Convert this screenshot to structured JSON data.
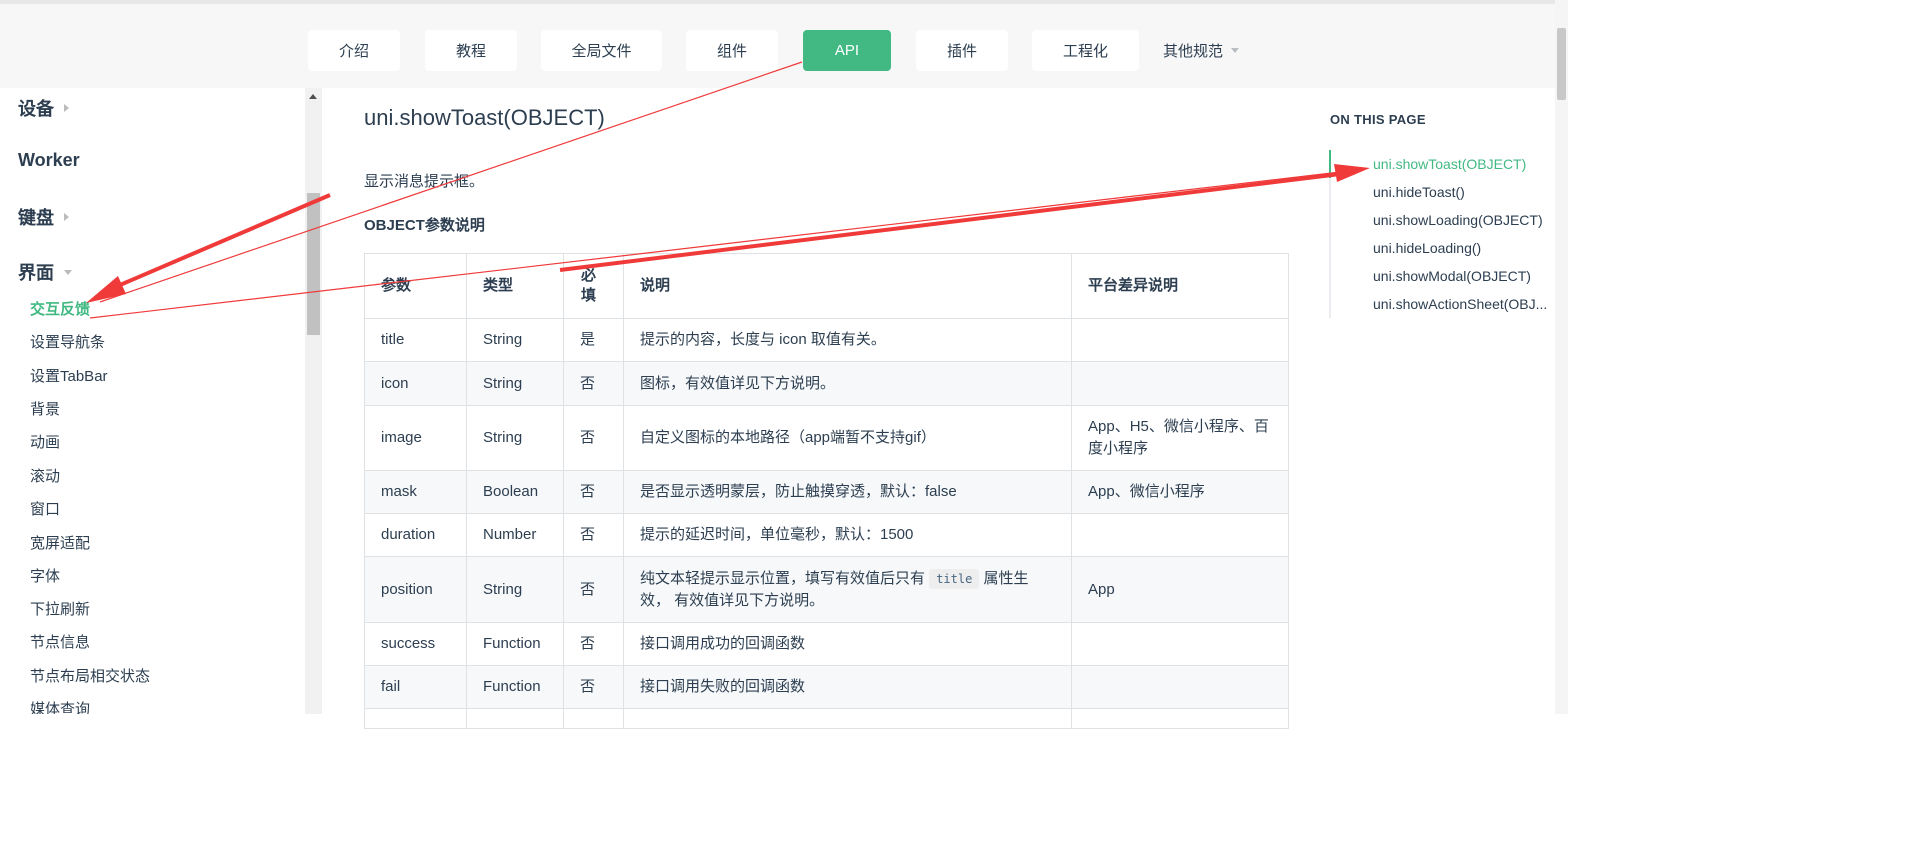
{
  "top_nav": {
    "items": [
      {
        "label": "介绍"
      },
      {
        "label": "教程"
      },
      {
        "label": "全局文件"
      },
      {
        "label": "组件"
      },
      {
        "label": "API"
      },
      {
        "label": "插件"
      },
      {
        "label": "工程化"
      },
      {
        "label": "其他规范"
      }
    ]
  },
  "sidebar": {
    "groups": [
      {
        "label": "设备"
      },
      {
        "label": "Worker"
      },
      {
        "label": "键盘"
      },
      {
        "label": "界面"
      }
    ],
    "items": [
      {
        "label": "交互反馈"
      },
      {
        "label": "设置导航条"
      },
      {
        "label": "设置TabBar"
      },
      {
        "label": "背景"
      },
      {
        "label": "动画"
      },
      {
        "label": "滚动"
      },
      {
        "label": "窗口"
      },
      {
        "label": "宽屏适配"
      },
      {
        "label": "字体"
      },
      {
        "label": "下拉刷新"
      },
      {
        "label": "节点信息"
      },
      {
        "label": "节点布局相交状态"
      },
      {
        "label": "媒体查询"
      }
    ]
  },
  "content": {
    "title": "uni.showToast(OBJECT)",
    "description": "显示消息提示框。",
    "section_title": "OBJECT参数说明",
    "table": {
      "headers": [
        "参数",
        "类型",
        "必填",
        "说明",
        "平台差异说明"
      ],
      "rows": [
        {
          "param": "title",
          "type": "String",
          "required": "是",
          "desc": "提示的内容，长度与 icon 取值有关。",
          "platform": ""
        },
        {
          "param": "icon",
          "type": "String",
          "required": "否",
          "desc": "图标，有效值详见下方说明。",
          "platform": ""
        },
        {
          "param": "image",
          "type": "String",
          "required": "否",
          "desc": "自定义图标的本地路径（app端暂不支持gif）",
          "platform": "App、H5、微信小程序、百度小程序"
        },
        {
          "param": "mask",
          "type": "Boolean",
          "required": "否",
          "desc": "是否显示透明蒙层，防止触摸穿透，默认：false",
          "platform": "App、微信小程序"
        },
        {
          "param": "duration",
          "type": "Number",
          "required": "否",
          "desc": "提示的延迟时间，单位毫秒，默认：1500",
          "platform": ""
        },
        {
          "param": "position",
          "type": "String",
          "required": "否",
          "desc_before": "纯文本轻提示显示位置，填写有效值后只有",
          "desc_code": "title",
          "desc_after": "属性生效， 有效值详见下方说明。",
          "platform": "App"
        },
        {
          "param": "success",
          "type": "Function",
          "required": "否",
          "desc": "接口调用成功的回调函数",
          "platform": ""
        },
        {
          "param": "fail",
          "type": "Function",
          "required": "否",
          "desc": "接口调用失败的回调函数",
          "platform": ""
        }
      ]
    }
  },
  "toc": {
    "title": "ON THIS PAGE",
    "items": [
      {
        "label": "uni.showToast(OBJECT)"
      },
      {
        "label": "uni.hideToast()"
      },
      {
        "label": "uni.showLoading(OBJECT)"
      },
      {
        "label": "uni.hideLoading()"
      },
      {
        "label": "uni.showModal(OBJECT)"
      },
      {
        "label": "uni.showActionSheet(OBJ..."
      }
    ]
  },
  "colors": {
    "accent": "#42b983",
    "annotation_arrow": "#f03a3a",
    "text": "#2c3e50"
  }
}
